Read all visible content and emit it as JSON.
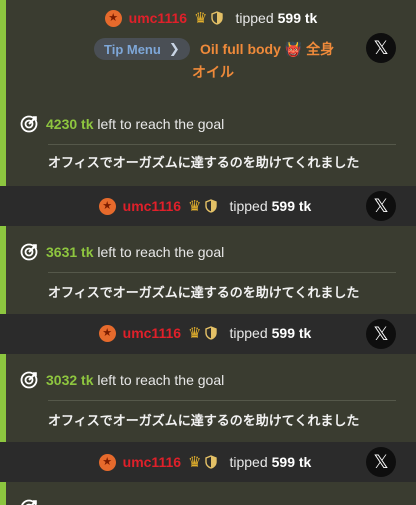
{
  "top_tip": {
    "username": "umc1116",
    "tipped_label": "tipped",
    "amount": "599 tk",
    "tip_menu_label": "Tip Menu",
    "menu_item_line1": "Oil full body 👹 全身",
    "menu_item_line2": "オイル"
  },
  "goals": [
    {
      "amount": "4230 tk",
      "text": "left to reach the goal",
      "description": "オフィスでオーガズムに達するのを助けてくれました"
    },
    {
      "amount": "3631 tk",
      "text": "left to reach the goal",
      "description": "オフィスでオーガズムに達するのを助けてくれました"
    },
    {
      "amount": "3032 tk",
      "text": "left to reach the goal",
      "description": "オフィスでオーガズムに達するのを助けてくれました"
    }
  ],
  "tips": [
    {
      "username": "umc1116",
      "tipped_label": "tipped",
      "amount": "599 tk"
    },
    {
      "username": "umc1116",
      "tipped_label": "tipped",
      "amount": "599 tk"
    },
    {
      "username": "umc1116",
      "tipped_label": "tipped",
      "amount": "599 tk"
    }
  ],
  "icons": {
    "star_badge": "star-badge-icon",
    "crown": "crown-icon",
    "shield": "shield-icon",
    "x_logo": "x-logo-icon",
    "goal": "goal-target-icon"
  },
  "colors": {
    "accent_green": "#8cc63f",
    "username_red": "#e0202a",
    "menu_orange": "#ef8a3a",
    "tip_menu_blue": "#7ea7d8"
  }
}
